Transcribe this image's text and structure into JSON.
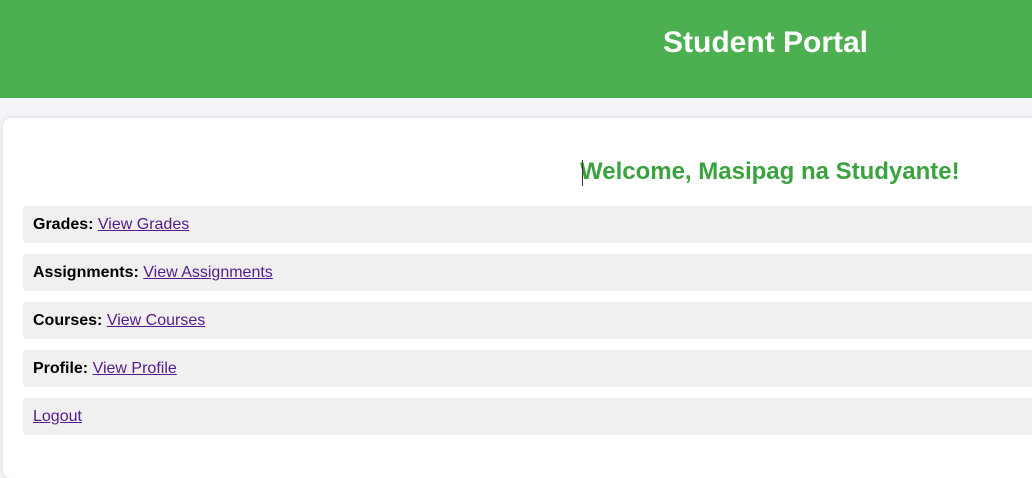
{
  "header": {
    "title": "Student Portal"
  },
  "welcome": {
    "text": "Welcome, Masipag na Studyante!"
  },
  "menu": {
    "grades": {
      "label": "Grades:",
      "link": "View Grades"
    },
    "assignments": {
      "label": "Assignments:",
      "link": "View Assignments"
    },
    "courses": {
      "label": "Courses:",
      "link": "View Courses"
    },
    "profile": {
      "label": "Profile:",
      "link": "View Profile"
    },
    "logout": {
      "link": "Logout"
    }
  },
  "colors": {
    "header_bg": "#4caf50",
    "welcome_text": "#3aa23e",
    "item_bg": "#f0f0f0",
    "visited_link": "#551a8b"
  }
}
